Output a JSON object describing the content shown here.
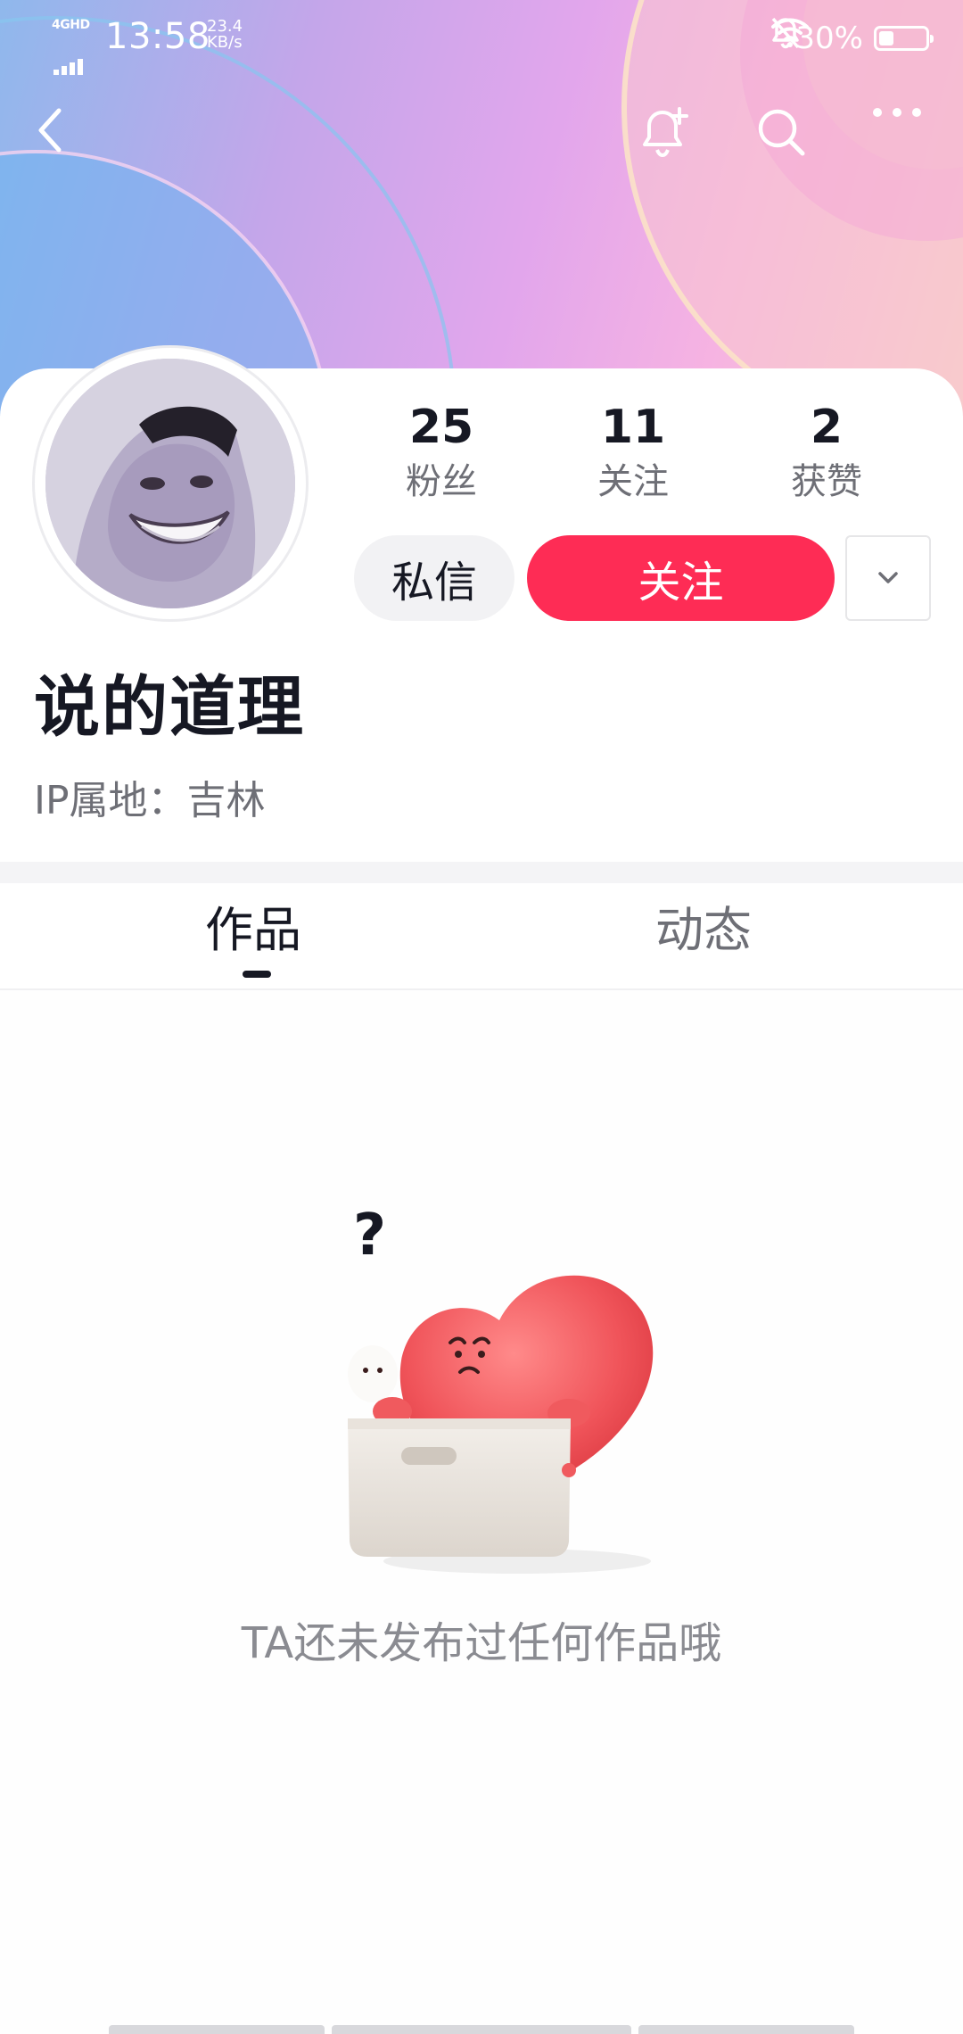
{
  "status_bar": {
    "network": "4GHD",
    "time": "13:58",
    "speed_value": "23.4",
    "speed_unit": "KB/s",
    "battery": "30%"
  },
  "nav": {
    "icons": [
      "back-icon",
      "bell-plus-icon",
      "search-icon",
      "more-icon"
    ]
  },
  "profile": {
    "nickname": "说的道理",
    "ip_location": "IP属地：吉林",
    "stats": [
      {
        "value": "25",
        "label": "粉丝"
      },
      {
        "value": "11",
        "label": "关注"
      },
      {
        "value": "2",
        "label": "获赞"
      }
    ],
    "message_button": "私信",
    "follow_button": "关注"
  },
  "tabs": [
    {
      "label": "作品",
      "active": true
    },
    {
      "label": "动态",
      "active": false
    }
  ],
  "empty_state": {
    "text": "TA还未发布过任何作品哦"
  },
  "colors": {
    "accent": "#fe2c55",
    "text_primary": "#161823",
    "text_secondary": "#6e6f76"
  }
}
